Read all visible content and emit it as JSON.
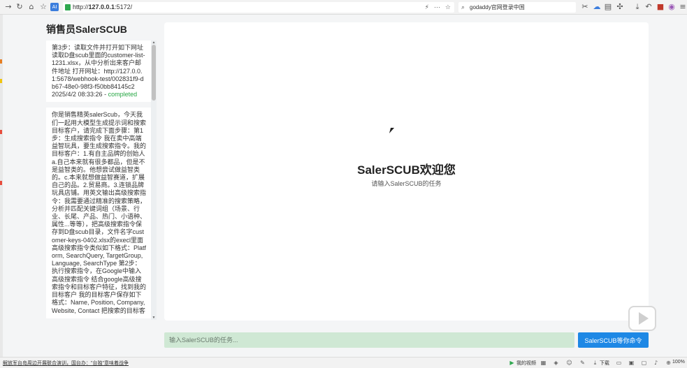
{
  "browser": {
    "url_prefix": "http://",
    "url_host": "127.0.0.1",
    "url_rest": ":5172/",
    "search_text": "godaddy官网登录中国",
    "icons": [
      "back-icon",
      "reload-icon",
      "home-icon",
      "star-icon",
      "translate-icon",
      "shield-icon",
      "bolt-icon",
      "more-icon",
      "star-outline-icon",
      "search-icon",
      "scissors-icon",
      "cloud-icon",
      "reader-icon",
      "puzzle-icon",
      "download-icon",
      "undo-icon",
      "wallet-icon",
      "color-icon",
      "menu-icon"
    ]
  },
  "sidebar": {
    "title": "销售员SalerSCUB",
    "history": [
      {
        "text": "第3步：读取文件并打开如下网址 读取D盘scub里面的customer-list-1231.xlsx，从中分析出来客户邮件地址 打开网址：http://127.0.0.1:5678/webhook-test/002831f9-db67-48e0-98f3-f50bb84145c2",
        "timestamp": "2025/4/2 08:33:26",
        "separator": " - ",
        "status": "completed"
      },
      {
        "text": "你是销售精英salerScub，今天我们一起用大模型生成提示词和搜索目标客户，请完成下面步骤：第1步：生成搜索指令 我在卖中高端益智玩具，要生成搜索指令。我的目标客户：1.有自主品牌的创始人 a.自己本来就有很多都品，但是不是益智类的。他想尝试做益智类的。c.本来就想做益智赛道，扩展自己的品。2.贸易商。3.连锁品牌玩具店铺。用英文输出高级搜索指令：我需要通过精准的搜索策略，分析并匹配关键词组（场景、行业、长尾、产品、热门、小语种、属性...等等），把高级搜索指令保存到D盘scub目录，文件名字customer-keys-0402.xlsx的execl里面 高级搜索指令类似如下格式：Platform, SearchQuery, TargetGroup, Language, SearchType 第2步：执行搜索指令，在Google中输入高级搜索指令 结合google高级搜索指令和目标客户特征，找到我的目标客户 我的目标客户保存如下格式：Name, Position, Company, Website, Contact 把搜索的目标客"
      }
    ]
  },
  "main": {
    "welcome_title": "SalerSCUB欢迎您",
    "welcome_subtitle": "请输入SalerSCUB的任务"
  },
  "input": {
    "placeholder": "输入SalerSCUB的任务...",
    "submit_label": "SalerSCUB等你命令"
  },
  "statusbar": {
    "news": "解放军台岛周边开展联合演训，国台办：\"台独\"意味着战争",
    "my_video": "我的视频",
    "download": "下载",
    "zoom": "100%"
  },
  "colors": {
    "accent": "#1e88e5",
    "input_bg": "#cfe8d4",
    "status_completed": "#28a745"
  }
}
